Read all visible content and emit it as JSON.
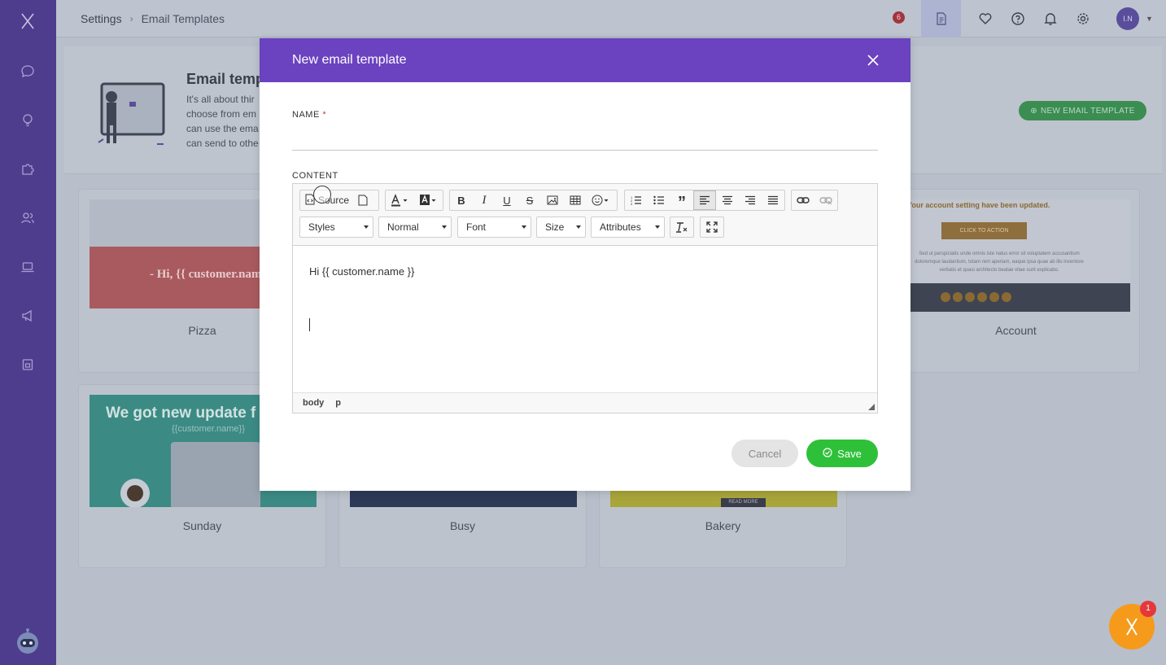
{
  "breadcrumb": {
    "root": "Settings",
    "separator": "›",
    "current": "Email Templates"
  },
  "topbar": {
    "badge_count": "6",
    "avatar_initials": "I.N"
  },
  "hero": {
    "title": "Email temp",
    "description": "It's all about thir choose from em can use the ema can send to othe",
    "new_button_label": "NEW EMAIL TEMPLATE"
  },
  "cards": [
    {
      "label": "Pizza",
      "thumb_text": "- Hi, {{ customer.nam"
    },
    {
      "label": "Account",
      "thumb_text": "Your account setting have been updated.",
      "cta": "CLICK TO ACTION",
      "body": "Sed ut perspiciatis unde omnis iste natus error sit voluptatem accusantium doloremque laudantium, totam rem aperiam, eaque ipsa quae ab illo inventore veritatis et quasi architecto beatae vitae sunt explicabo."
    },
    {
      "label": "Sunday",
      "thumb_title": "We got new update f",
      "thumb_sub": "{{customer.name}}"
    },
    {
      "label": "Busy"
    },
    {
      "label": "Bakery",
      "thumb_button": "READ MORE"
    }
  ],
  "modal": {
    "title": "New email template",
    "name_label": "NAME",
    "required_mark": "*",
    "name_value": "",
    "content_label": "CONTENT",
    "toolbar": {
      "source_label": "Source",
      "styles": "Styles",
      "format": "Normal",
      "font": "Font",
      "size": "Size",
      "attributes": "Attributes"
    },
    "editor_text": "Hi {{ customer.name }}",
    "path": [
      "body",
      "p"
    ],
    "cancel_label": "Cancel",
    "save_label": "Save"
  },
  "fab_badge": "1",
  "colors": {
    "sidebar": "#4e3d8c",
    "modal_header": "#6b42bf",
    "save": "#2fc03a",
    "fab": "#f59a1b"
  }
}
